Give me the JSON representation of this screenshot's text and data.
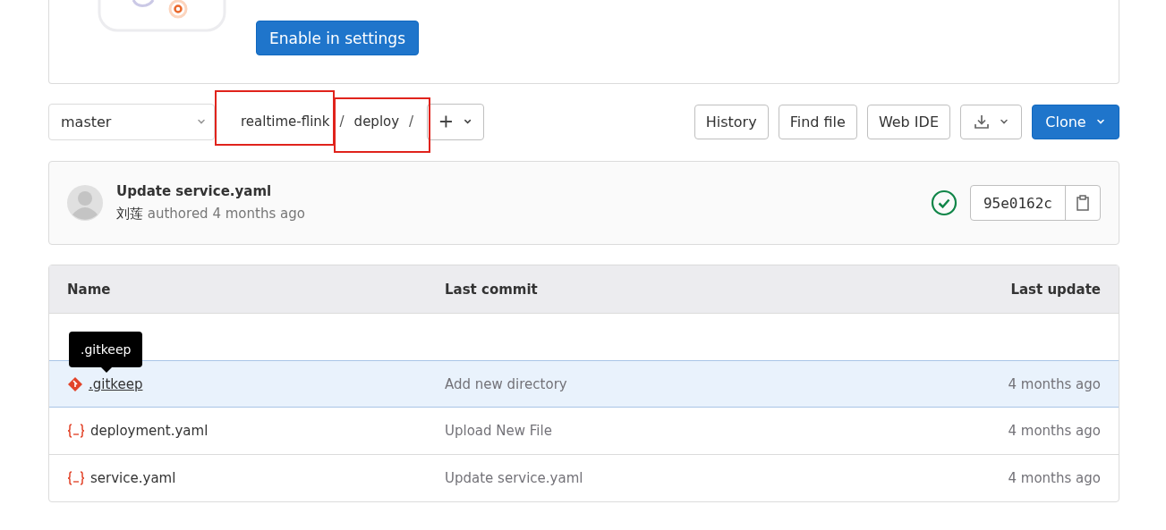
{
  "settings_card": {
    "button": "Enable in settings"
  },
  "branch": {
    "value": "master"
  },
  "breadcrumbs": [
    {
      "label": "realtime-flink",
      "separator": "/",
      "highlighted": true
    },
    {
      "label": "deploy",
      "separator": "/",
      "highlighted": true
    }
  ],
  "actions": [
    "History",
    "Find file",
    "Web IDE"
  ],
  "clone": "Clone",
  "commit": {
    "title": "Update service.yaml",
    "author": "刘莲",
    "meta": "authored 4 months ago",
    "passed": true,
    "sha": "95e0162c"
  },
  "table": {
    "columns": [
      "Name",
      "Last commit",
      "Last update"
    ],
    "rows": [
      {
        "kind": "parent"
      },
      {
        "kind": "git",
        "name": ".gitkeep",
        "commit": "Add new directory",
        "updated": "4 months ago",
        "selected": true,
        "tooltip": ".gitkeep"
      },
      {
        "kind": "yaml",
        "name": "deployment.yaml",
        "commit": "Upload New File",
        "updated": "4 months ago",
        "selected": false
      },
      {
        "kind": "yaml",
        "name": "service.yaml",
        "commit": "Update service.yaml",
        "updated": "4 months ago",
        "selected": false
      }
    ]
  }
}
